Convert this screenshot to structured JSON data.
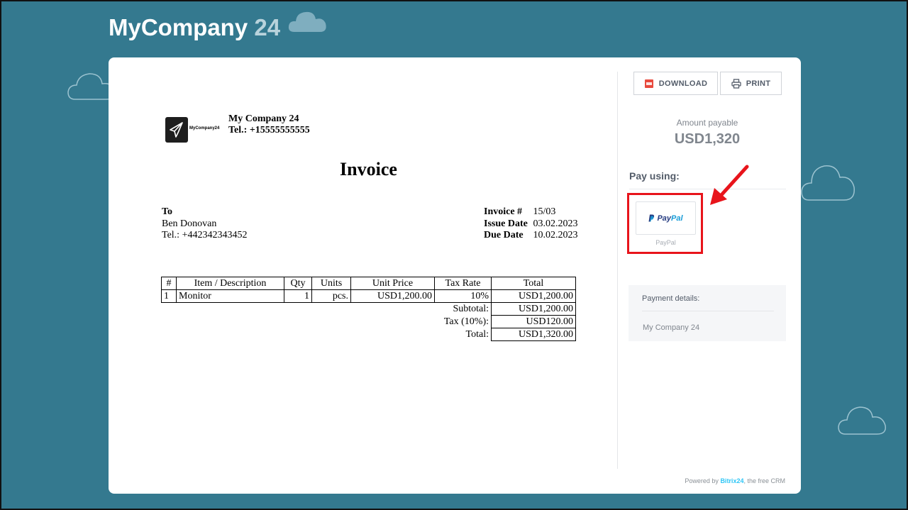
{
  "header": {
    "brand_main": "MyCompany",
    "brand_num": "24"
  },
  "invoice": {
    "logo_text": "MyCompany24",
    "company_name": "My Company 24",
    "company_phone": "Tel.: +15555555555",
    "title": "Invoice",
    "to_label": "To",
    "client_name": "Ben Donovan",
    "client_phone": "Tel.: +442342343452",
    "meta": [
      {
        "label": "Invoice #",
        "value": "15/03"
      },
      {
        "label": "Issue Date",
        "value": "03.02.2023"
      },
      {
        "label": "Due Date",
        "value": "10.02.2023"
      }
    ],
    "columns": [
      "#",
      "Item / Description",
      "Qty",
      "Units",
      "Unit Price",
      "Tax Rate",
      "Total"
    ],
    "rows": [
      {
        "num": "1",
        "item": "Monitor",
        "qty": "1",
        "units": "pcs.",
        "unit_price": "USD1,200.00",
        "tax_rate": "10%",
        "total": "USD1,200.00"
      }
    ],
    "totals": [
      {
        "label": "Subtotal:",
        "value": "USD1,200.00"
      },
      {
        "label": "Tax (10%):",
        "value": "USD120.00"
      },
      {
        "label": "Total:",
        "value": "USD1,320.00"
      }
    ]
  },
  "sidebar": {
    "download_label": "DOWNLOAD",
    "print_label": "PRINT",
    "amount_label": "Amount payable",
    "amount_value": "USD1,320",
    "pay_using_label": "Pay using:",
    "paypal_logo": "PayPal",
    "paypal_caption": "PayPal",
    "payment_details_label": "Payment details:",
    "payment_details_value": "My Company 24"
  },
  "footer": {
    "powered_prefix": "Powered by",
    "powered_brand": "Bitrix24",
    "powered_suffix": ", the free CRM"
  },
  "colors": {
    "background": "#34798f",
    "highlight": "#e8141b",
    "paypal_dark": "#253b80",
    "paypal_light": "#179bd7"
  }
}
